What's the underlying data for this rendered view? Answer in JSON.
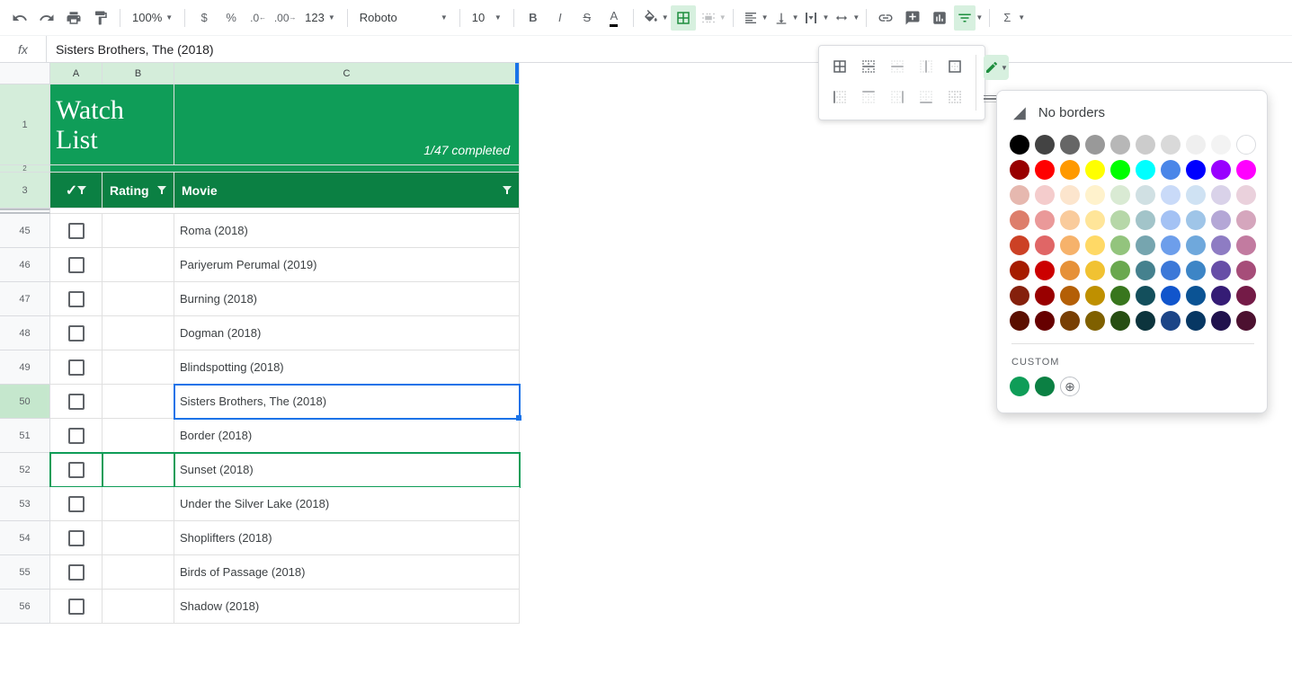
{
  "toolbar": {
    "zoom": "100%",
    "font": "Roboto",
    "size": "10"
  },
  "formula": {
    "fx": "fx",
    "value": "Sisters Brothers, The (2018)"
  },
  "columns": [
    "A",
    "B",
    "C"
  ],
  "header": {
    "title_line1": "Watch",
    "title_line2": "List",
    "completed": "1/47 completed",
    "check": "✓",
    "rating": "Rating",
    "movie": "Movie"
  },
  "rows": [
    {
      "n": "1",
      "big": true
    },
    {
      "n": "2",
      "hidden": true
    },
    {
      "n": "3",
      "hdr": true
    },
    {
      "n": "45",
      "movie": "Roma (2018)"
    },
    {
      "n": "46",
      "movie": "Pariyerum Perumal (2019)"
    },
    {
      "n": "47",
      "movie": "Burning (2018)"
    },
    {
      "n": "48",
      "movie": "Dogman (2018)"
    },
    {
      "n": "49",
      "movie": "Blindspotting (2018)"
    },
    {
      "n": "50",
      "movie": "Sisters Brothers, The (2018)",
      "selected": true
    },
    {
      "n": "51",
      "movie": "Border (2018)"
    },
    {
      "n": "52",
      "movie": "Sunset (2018)",
      "greenbox": true
    },
    {
      "n": "53",
      "movie": "Under the Silver Lake (2018)"
    },
    {
      "n": "54",
      "movie": "Shoplifters (2018)"
    },
    {
      "n": "55",
      "movie": "Birds of Passage (2018)"
    },
    {
      "n": "56",
      "movie": "Shadow (2018)"
    }
  ],
  "colorPanel": {
    "noBorders": "No borders",
    "custom": "CUSTOM",
    "standard": [
      [
        "#000000",
        "#434343",
        "#666666",
        "#999999",
        "#b7b7b7",
        "#cccccc",
        "#d9d9d9",
        "#efefef",
        "#f3f3f3",
        "#ffffff"
      ],
      [
        "#980000",
        "#ff0000",
        "#ff9900",
        "#ffff00",
        "#00ff00",
        "#00ffff",
        "#4a86e8",
        "#0000ff",
        "#9900ff",
        "#ff00ff"
      ],
      [
        "#e6b8af",
        "#f4cccc",
        "#fce5cd",
        "#fff2cc",
        "#d9ead3",
        "#d0e0e3",
        "#c9daf8",
        "#cfe2f3",
        "#d9d2e9",
        "#ead1dc"
      ],
      [
        "#dd7e6b",
        "#ea9999",
        "#f9cb9c",
        "#ffe599",
        "#b6d7a8",
        "#a2c4c9",
        "#a4c2f4",
        "#9fc5e8",
        "#b4a7d6",
        "#d5a6bd"
      ],
      [
        "#cc4125",
        "#e06666",
        "#f6b26b",
        "#ffd966",
        "#93c47d",
        "#76a5af",
        "#6d9eeb",
        "#6fa8dc",
        "#8e7cc3",
        "#c27ba0"
      ],
      [
        "#a61c00",
        "#cc0000",
        "#e69138",
        "#f1c232",
        "#6aa84f",
        "#45818e",
        "#3c78d8",
        "#3d85c6",
        "#674ea7",
        "#a64d79"
      ],
      [
        "#85200c",
        "#990000",
        "#b45f06",
        "#bf9000",
        "#38761d",
        "#134f5c",
        "#1155cc",
        "#0b5394",
        "#351c75",
        "#741b47"
      ],
      [
        "#5b0f00",
        "#660000",
        "#783f04",
        "#7f6000",
        "#274e13",
        "#0c343d",
        "#1c4587",
        "#073763",
        "#20124d",
        "#4c1130"
      ]
    ],
    "customColors": [
      "#0f9d58",
      "#0b8043"
    ]
  }
}
